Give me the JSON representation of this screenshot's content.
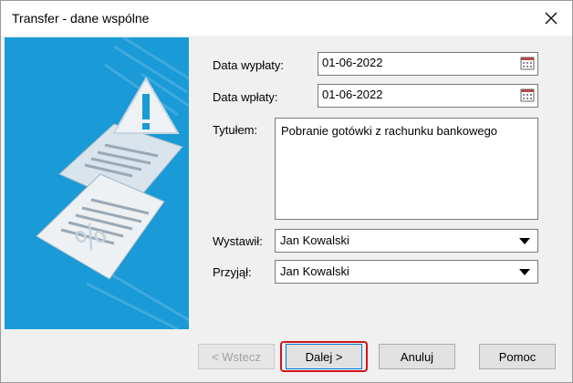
{
  "window": {
    "title": "Transfer - dane wspólne"
  },
  "form": {
    "data_wyplaty": {
      "label": "Data wypłaty:",
      "value": "01-06-2022"
    },
    "data_wplaty": {
      "label": "Data wpłaty:",
      "value": "01-06-2022"
    },
    "tytulem": {
      "label": "Tytułem:",
      "value": "Pobranie gotówki z rachunku bankowego"
    },
    "wystawil": {
      "label": "Wystawił:",
      "value": "Jan Kowalski"
    },
    "przyjal": {
      "label": "Przyjął:",
      "value": "Jan Kowalski"
    }
  },
  "buttons": {
    "back": "< Wstecz",
    "next": "Dalej >",
    "cancel": "Anuluj",
    "help": "Pomoc"
  },
  "colors": {
    "panel": "#1a9ad6",
    "highlight": "#d0161b"
  },
  "icons": [
    "close-icon",
    "calendar-icon",
    "chevron-down-icon",
    "warning-icon",
    "document-icon"
  ]
}
